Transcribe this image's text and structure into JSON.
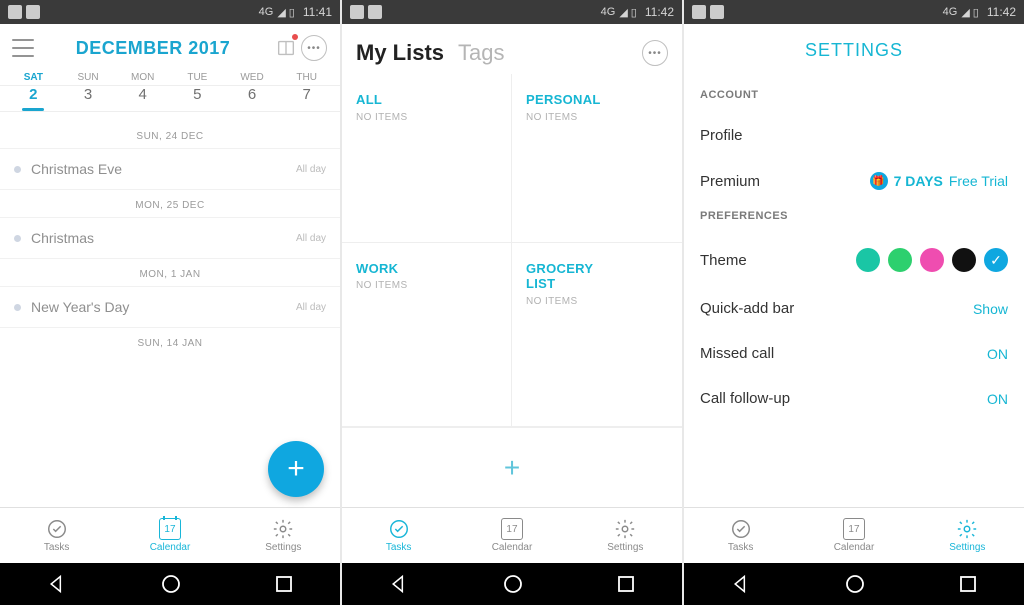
{
  "statusbar": {
    "network": "4G",
    "times": [
      "11:41",
      "11:42",
      "11:42"
    ]
  },
  "nav": {
    "tasks": "Tasks",
    "calendar": "Calendar",
    "settings": "Settings",
    "cal_icon_date": "17"
  },
  "screen1": {
    "month_title": "DECEMBER 2017",
    "weekdays": [
      "SAT",
      "SUN",
      "MON",
      "TUE",
      "WED",
      "THU"
    ],
    "dates": [
      "2",
      "3",
      "4",
      "5",
      "6",
      "7"
    ],
    "active_day_index": 0,
    "agenda": [
      {
        "header": "SUN, 24 DEC",
        "title": "Christmas Eve",
        "allday": "All day"
      },
      {
        "header": "MON, 25 DEC",
        "title": "Christmas",
        "allday": "All day"
      },
      {
        "header": "MON, 1 JAN",
        "title": "New Year's Day",
        "allday": "All day"
      },
      {
        "header": "SUN, 14 JAN"
      }
    ]
  },
  "screen2": {
    "title": "My Lists",
    "tags_label": "Tags",
    "no_items": "NO ITEMS",
    "lists": [
      "ALL",
      "PERSONAL",
      "WORK",
      "GROCERY LIST"
    ]
  },
  "screen3": {
    "title": "SETTINGS",
    "account_label": "ACCOUNT",
    "profile": "Profile",
    "premium": "Premium",
    "trial_days": "7 DAYS",
    "trial_text": "Free Trial",
    "prefs_label": "PREFERENCES",
    "theme": "Theme",
    "theme_colors": [
      "#1ac6a5",
      "#2dd06e",
      "#ef4db0",
      "#111111",
      "#0fa7e0"
    ],
    "theme_selected_index": 4,
    "quickadd": "Quick-add bar",
    "quickadd_val": "Show",
    "missed": "Missed call",
    "missed_val": "ON",
    "followup": "Call follow-up",
    "followup_val": "ON"
  }
}
